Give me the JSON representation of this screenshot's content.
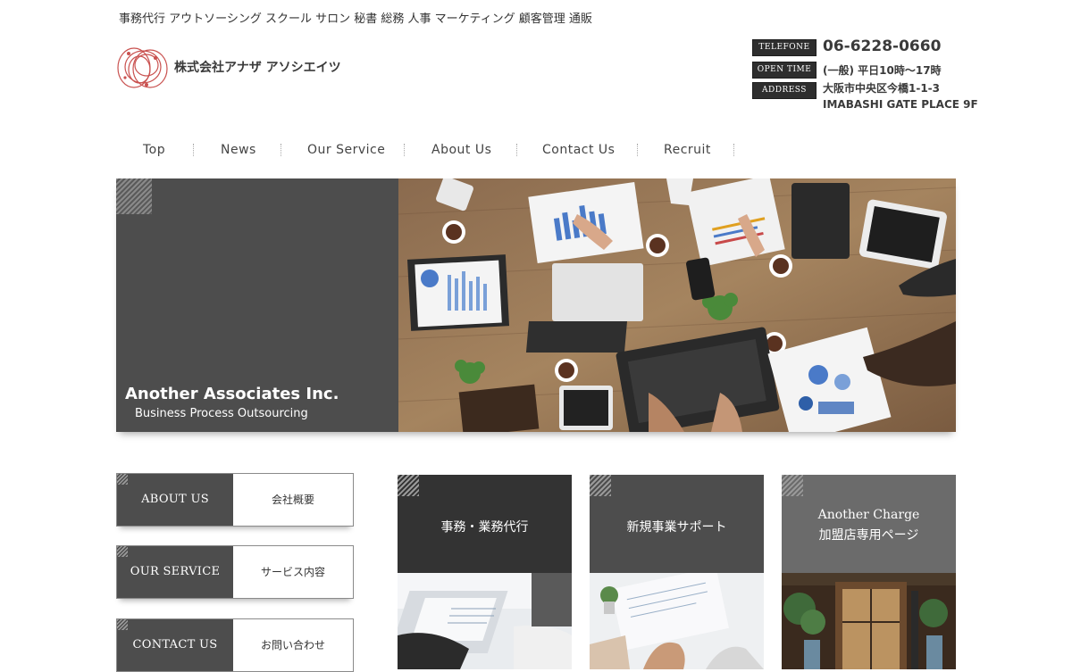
{
  "header": {
    "tagline": "事務代行 アウトソーシング スクール サロン 秘書 総務 人事 マーケティング 顧客管理 通販",
    "company_name": "株式会社アナザ アソシエイツ",
    "logo_icon": "circles-logo-icon"
  },
  "contact": {
    "phone_label": "TELEFONE",
    "phone": "06-6228-0660",
    "hours_label": "OPEN TIME",
    "hours": "(一般) 平日10時～17時",
    "address_label": "ADDRESS",
    "address_line1": "大阪市中央区今橋1-1-3",
    "address_line2": "IMABASHI GATE PLACE 9F"
  },
  "nav": {
    "items": [
      {
        "label": "Top"
      },
      {
        "label": "News"
      },
      {
        "label": "Our Service"
      },
      {
        "label": "About Us"
      },
      {
        "label": "Contact Us"
      },
      {
        "label": "Recruit"
      }
    ]
  },
  "hero": {
    "title": "Another Associates Inc.",
    "subtitle": "Business Process Outsourcing",
    "image": "office-meeting-table-photo"
  },
  "side_menu": [
    {
      "en": "ABOUT US",
      "jp": "会社概要"
    },
    {
      "en": "OUR SERVICE",
      "jp": "サービス内容"
    },
    {
      "en": "CONTACT US",
      "jp": "お問い合わせ"
    }
  ],
  "cards": [
    {
      "title_line1": "事務・業務代行",
      "title_line2": "",
      "image": "laptop-document-photo"
    },
    {
      "title_line1": "新規事業サポート",
      "title_line2": "",
      "image": "meeting-papers-photo"
    },
    {
      "title_line1": "Another Charge",
      "title_line2": "加盟店専用ページ",
      "image": "shop-entrance-photo"
    }
  ],
  "colors": {
    "dark_panel": "#4d4d4d",
    "card1": "#333333",
    "card2": "#4d4d4d",
    "card3": "#6b6b6b",
    "text": "#333333"
  }
}
